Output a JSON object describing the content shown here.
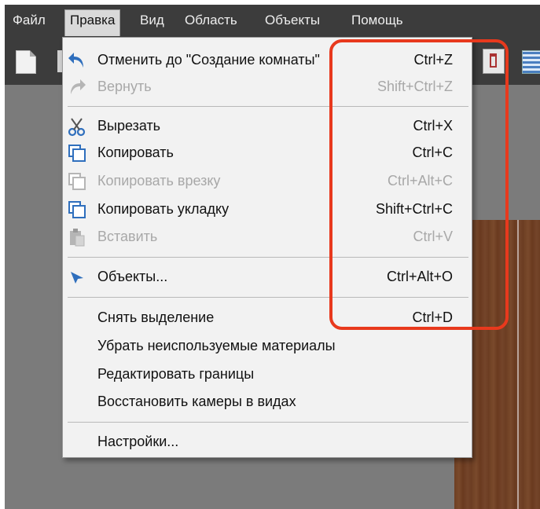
{
  "menubar": {
    "items": [
      {
        "label": "Файл"
      },
      {
        "label": "Правка",
        "active": true
      },
      {
        "label": "Вид"
      },
      {
        "label": "Область"
      },
      {
        "label": "Объекты"
      },
      {
        "label": "Помощь"
      }
    ]
  },
  "edit_menu": {
    "items": [
      {
        "label": "Отменить до \"Создание комнаты\"",
        "shortcut": "Ctrl+Z",
        "icon": "undo-icon",
        "enabled": true
      },
      {
        "label": "Вернуть",
        "shortcut": "Shift+Ctrl+Z",
        "icon": "redo-icon",
        "enabled": false
      },
      {
        "label": "Вырезать",
        "shortcut": "Ctrl+X",
        "icon": "scissors-icon",
        "enabled": true
      },
      {
        "label": "Копировать",
        "shortcut": "Ctrl+C",
        "icon": "copy-icon",
        "enabled": true
      },
      {
        "label": "Копировать врезку",
        "shortcut": "Ctrl+Alt+C",
        "icon": "copy-icon",
        "enabled": false
      },
      {
        "label": "Копировать укладку",
        "shortcut": "Shift+Ctrl+C",
        "icon": "copy-icon",
        "enabled": true
      },
      {
        "label": "Вставить",
        "shortcut": "Ctrl+V",
        "icon": "paste-icon",
        "enabled": false
      },
      {
        "label": "Объекты...",
        "shortcut": "Ctrl+Alt+O",
        "icon": "cursor-arrow-icon",
        "enabled": true
      },
      {
        "label": "Снять выделение",
        "shortcut": "Ctrl+D",
        "enabled": true
      },
      {
        "label": "Убрать неиспользуемые материалы",
        "shortcut": "",
        "enabled": true
      },
      {
        "label": "Редактировать границы",
        "shortcut": "",
        "enabled": true
      },
      {
        "label": "Восстановить камеры в видах",
        "shortcut": "",
        "enabled": true
      },
      {
        "label": "Настройки...",
        "shortcut": "",
        "enabled": true
      }
    ]
  },
  "colors": {
    "menubar_bg": "#3c3c3c",
    "menu_bg": "#f2f2f2",
    "highlight_border": "#e8391d",
    "icon_blue": "#2f6fbd"
  }
}
